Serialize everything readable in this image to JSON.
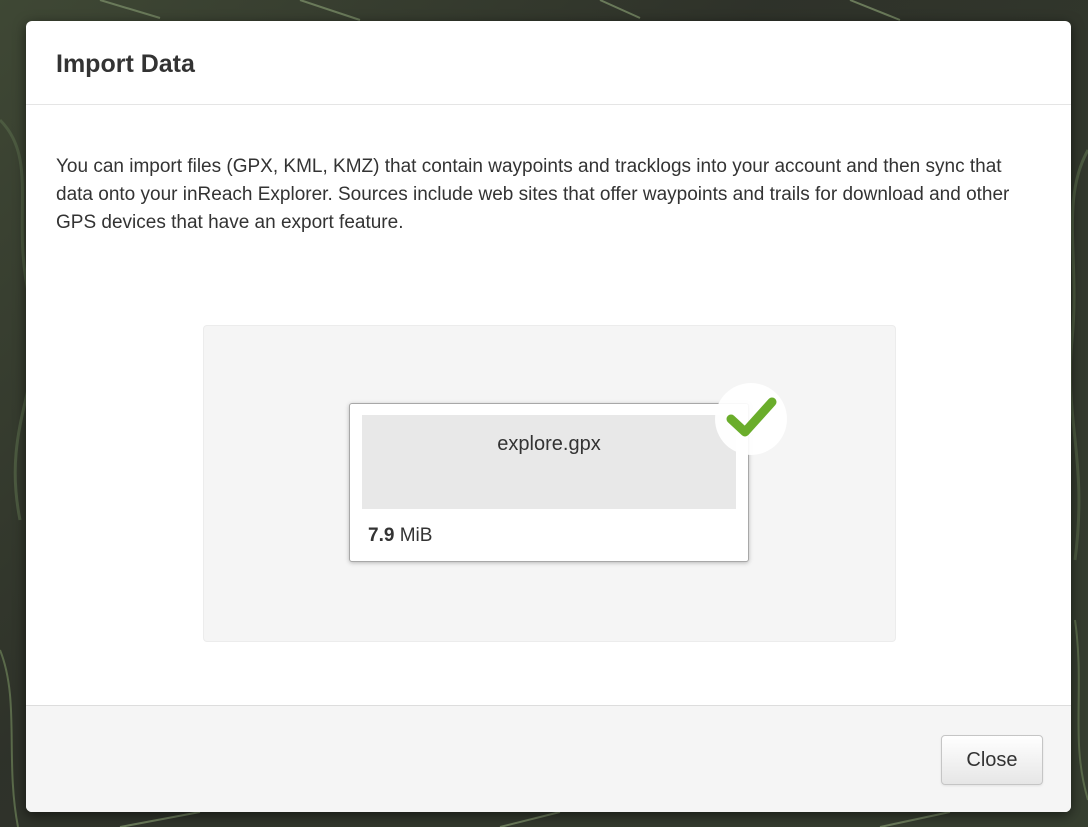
{
  "modal": {
    "title": "Import Data",
    "description": "You can import files (GPX, KML, KMZ) that contain waypoints and tracklogs into your account and then sync that data onto your inReach Explorer. Sources include web sites that offer waypoints and trails for download and other GPS devices that have an export feature.",
    "file": {
      "name": "explore.gpx",
      "size_value": "7.9",
      "size_unit": "MiB",
      "status_icon": "checkmark-icon",
      "status_color": "#6aad2b"
    },
    "footer": {
      "close_label": "Close"
    }
  }
}
